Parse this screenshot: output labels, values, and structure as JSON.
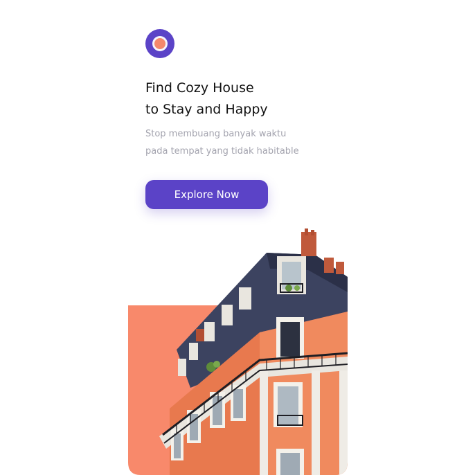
{
  "logo": {
    "icon": "target-circle-logo",
    "outer_color": "#5B43C7",
    "inner_color": "#F5886C"
  },
  "heading": {
    "line1": "Find Cozy House",
    "line2": "to Stay and Happy"
  },
  "subheading": {
    "line1": "Stop membuang banyak waktu",
    "line2": "pada tempat yang tidak habitable"
  },
  "cta": {
    "label": "Explore Now",
    "color": "#5B43C7"
  },
  "hero": {
    "image": "apartment-building-photo",
    "accent_color": "#F8896B"
  }
}
